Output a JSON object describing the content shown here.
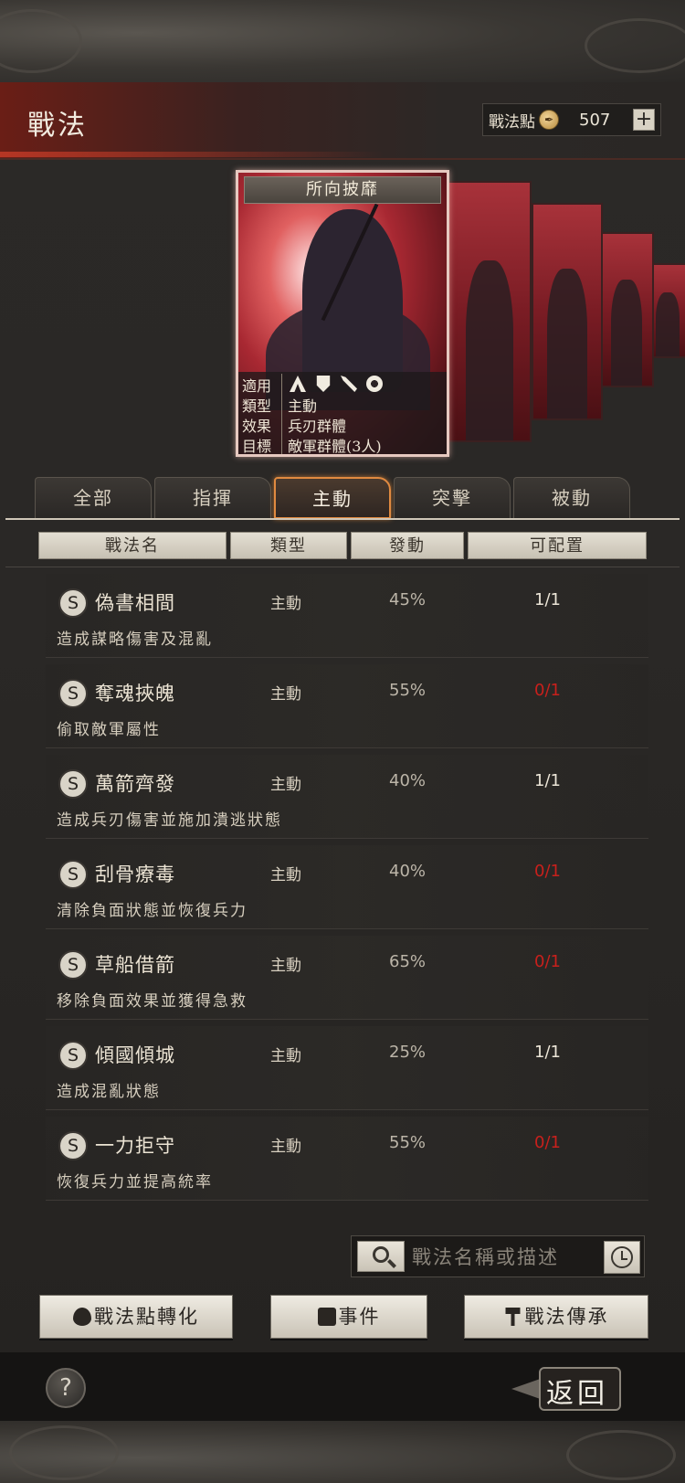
{
  "header": {
    "title": "戰法",
    "points_label": "戰法點",
    "points_value": "507",
    "plus": "+"
  },
  "featured_card": {
    "name": "所向披靡",
    "info": [
      {
        "key": "適用",
        "value": ""
      },
      {
        "key": "類型",
        "value": "主動"
      },
      {
        "key": "效果",
        "value": "兵刃群體"
      },
      {
        "key": "目標",
        "value": "敵軍群體(3人)"
      }
    ],
    "applicable_icons": [
      "cavalry-icon",
      "shield-icon",
      "bow-icon",
      "wheel-icon"
    ]
  },
  "tabs": [
    {
      "label": "全部"
    },
    {
      "label": "指揮"
    },
    {
      "label": "主動",
      "active": true
    },
    {
      "label": "突擊"
    },
    {
      "label": "被動"
    }
  ],
  "columns": [
    "戰法名",
    "類型",
    "發動",
    "可配置"
  ],
  "skills": [
    {
      "grade": "S",
      "name": "偽書相間",
      "type": "主動",
      "rate": "45%",
      "avail": "1/1",
      "desc": "造成謀略傷害及混亂"
    },
    {
      "grade": "S",
      "name": "奪魂挾魄",
      "type": "主動",
      "rate": "55%",
      "avail": "0/1",
      "desc": "偷取敵軍屬性"
    },
    {
      "grade": "S",
      "name": "萬箭齊發",
      "type": "主動",
      "rate": "40%",
      "avail": "1/1",
      "desc": "造成兵刃傷害並施加潰逃狀態"
    },
    {
      "grade": "S",
      "name": "刮骨療毒",
      "type": "主動",
      "rate": "40%",
      "avail": "0/1",
      "desc": "清除負面狀態並恢復兵力"
    },
    {
      "grade": "S",
      "name": "草船借箭",
      "type": "主動",
      "rate": "65%",
      "avail": "0/1",
      "desc": "移除負面效果並獲得急救"
    },
    {
      "grade": "S",
      "name": "傾國傾城",
      "type": "主動",
      "rate": "25%",
      "avail": "1/1",
      "desc": "造成混亂狀態"
    },
    {
      "grade": "S",
      "name": "一力拒守",
      "type": "主動",
      "rate": "55%",
      "avail": "0/1",
      "desc": "恢復兵力並提高統率"
    }
  ],
  "search": {
    "placeholder": "戰法名稱或描述"
  },
  "buttons": {
    "convert": "戰法點轉化",
    "event": "事件",
    "inherit": "戰法傳承"
  },
  "footer": {
    "help": "?",
    "back": "返回"
  },
  "colors": {
    "accent_orange": "#e08a40",
    "unavailable_red": "#c8201c",
    "header_red": "#6a1e16"
  }
}
